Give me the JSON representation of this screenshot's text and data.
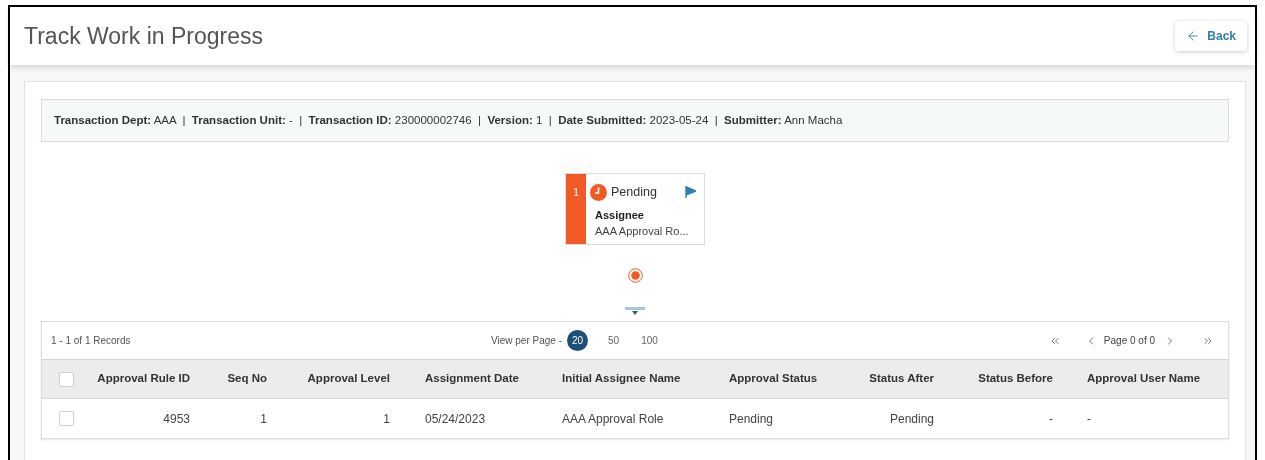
{
  "header": {
    "title": "Track Work in Progress",
    "back_button": "Back"
  },
  "summary": "**Transaction Dept:** AAA  |  **Transaction Unit:** -  |  **Transaction ID:** 230000002746  |  **Version:** 1  |  **Date Submitted:** 2023-05-24  |  **Submitter:** Ann Macha",
  "workflow": {
    "steps": [
      {
        "number": "1",
        "status": "Pending",
        "color": "#f15a24",
        "assignee_label": "Assignee",
        "assignee": "AAA Approval Ro..."
      }
    ]
  },
  "table": {
    "records": "1 - 1 of 1 Records",
    "view_per_page": "View per Page -",
    "page_sizes": [
      {
        "label": "20",
        "selected": true
      },
      {
        "label": "50",
        "selected": false
      },
      {
        "label": "100",
        "selected": false
      }
    ],
    "page": "Page 0 of 0",
    "header_checked": false,
    "columns": [
      "Approval Rule ID",
      "Seq No",
      "Approval Level",
      "Assignment Date",
      "Initial Assignee Name",
      "Approval Status",
      "Status After",
      "Status Before",
      "Approval User Name"
    ],
    "rows": [
      {
        "checked": false,
        "cells": [
          "4953",
          "1",
          "1",
          "05/24/2023",
          "AAA Approval Role",
          "Pending",
          "Pending",
          "-",
          "-"
        ]
      }
    ]
  }
}
